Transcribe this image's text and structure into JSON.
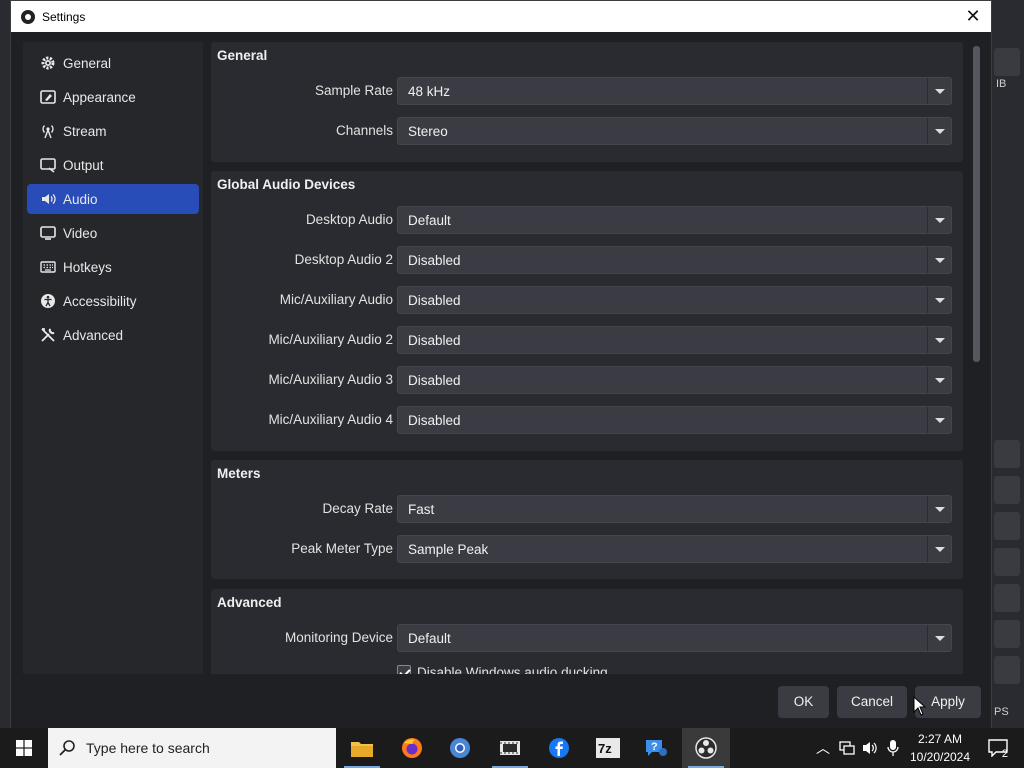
{
  "window": {
    "title": "Settings"
  },
  "sidebar": {
    "items": [
      {
        "label": "General",
        "icon": "gear-icon"
      },
      {
        "label": "Appearance",
        "icon": "appearance-icon"
      },
      {
        "label": "Stream",
        "icon": "antenna-icon"
      },
      {
        "label": "Output",
        "icon": "output-icon"
      },
      {
        "label": "Audio",
        "icon": "speaker-icon",
        "active": true
      },
      {
        "label": "Video",
        "icon": "monitor-icon"
      },
      {
        "label": "Hotkeys",
        "icon": "keyboard-icon"
      },
      {
        "label": "Accessibility",
        "icon": "accessibility-icon"
      },
      {
        "label": "Advanced",
        "icon": "tools-icon"
      }
    ]
  },
  "general_group": {
    "title": "General",
    "sample_rate": {
      "label": "Sample Rate",
      "value": "48 kHz"
    },
    "channels": {
      "label": "Channels",
      "value": "Stereo"
    }
  },
  "global_audio": {
    "title": "Global Audio Devices",
    "desktop_audio": {
      "label": "Desktop Audio",
      "value": "Default"
    },
    "desktop_audio_2": {
      "label": "Desktop Audio 2",
      "value": "Disabled"
    },
    "mic_aux_audio": {
      "label": "Mic/Auxiliary Audio",
      "value": "Disabled"
    },
    "mic_aux_audio_2": {
      "label": "Mic/Auxiliary Audio 2",
      "value": "Disabled"
    },
    "mic_aux_audio_3": {
      "label": "Mic/Auxiliary Audio 3",
      "value": "Disabled"
    },
    "mic_aux_audio_4": {
      "label": "Mic/Auxiliary Audio 4",
      "value": "Disabled"
    }
  },
  "meters": {
    "title": "Meters",
    "decay_rate": {
      "label": "Decay Rate",
      "value": "Fast"
    },
    "peak_meter_type": {
      "label": "Peak Meter Type",
      "value": "Sample Peak"
    }
  },
  "advanced": {
    "title": "Advanced",
    "monitoring_device": {
      "label": "Monitoring Device",
      "value": "Default"
    },
    "ducking": {
      "label": "Disable Windows audio ducking",
      "checked": true
    }
  },
  "buttons": {
    "ok": "OK",
    "cancel": "Cancel",
    "apply": "Apply"
  },
  "taskbar": {
    "search_placeholder": "Type here to search",
    "time": "2:27 AM",
    "date": "10/20/2024",
    "notification_count": "2"
  },
  "background_app": {
    "right_labels": [
      "IB",
      "PS"
    ]
  },
  "colors": {
    "accent": "#284cb8",
    "window_bg": "#1f2024",
    "group_bg": "#2a2b30",
    "select_bg": "#3b3c43"
  }
}
